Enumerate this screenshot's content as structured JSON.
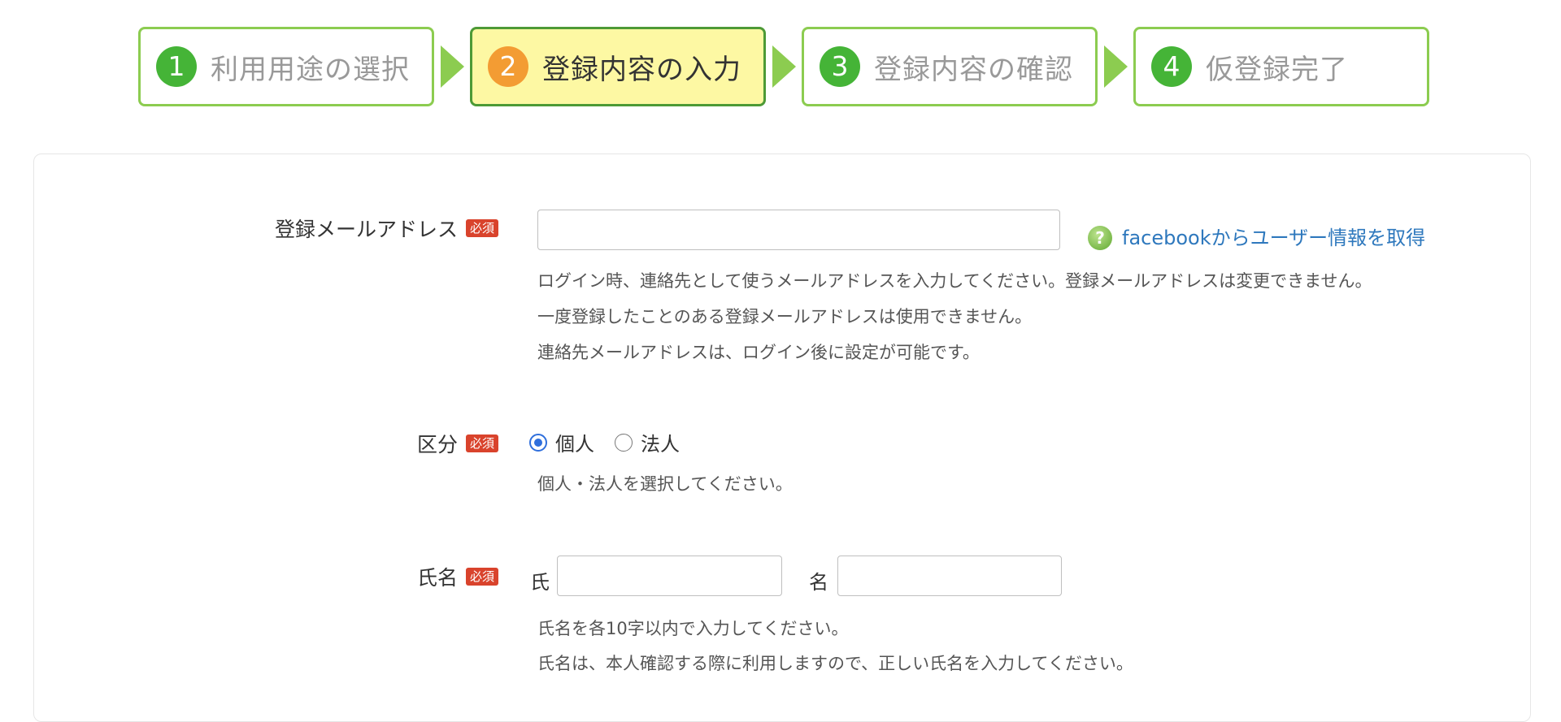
{
  "steps": [
    {
      "num": "1",
      "label": "利用用途の選択"
    },
    {
      "num": "2",
      "label": "登録内容の入力"
    },
    {
      "num": "3",
      "label": "登録内容の確認"
    },
    {
      "num": "4",
      "label": "仮登録完了"
    }
  ],
  "active_step": 2,
  "colors": {
    "step_border": "#8ccc50",
    "step_active_bg": "#fdf8a3",
    "step_num_green": "#45b437",
    "step_num_orange": "#f39c33",
    "required_badge": "#d9432c",
    "link": "#2e78bd"
  },
  "required_badge": "必須",
  "form": {
    "email": {
      "label": "登録メールアドレス",
      "value": "",
      "placeholder": "",
      "facebook_link": "facebookからユーザー情報を取得",
      "notes": [
        "ログイン時、連絡先として使うメールアドレスを入力してください。登録メールアドレスは変更できません。",
        "一度登録したことのある登録メールアドレスは使用できません。",
        "連絡先メールアドレスは、ログイン後に設定が可能です。"
      ]
    },
    "category": {
      "label": "区分",
      "options": [
        "個人",
        "法人"
      ],
      "selected": "個人",
      "note": "個人・法人を選択してください。"
    },
    "name": {
      "label": "氏名",
      "last_label": "氏",
      "first_label": "名",
      "last_value": "",
      "first_value": "",
      "notes": [
        "氏名を各10字以内で入力してください。",
        "氏名は、本人確認する際に利用しますので、正しい氏名を入力してください。"
      ]
    }
  }
}
